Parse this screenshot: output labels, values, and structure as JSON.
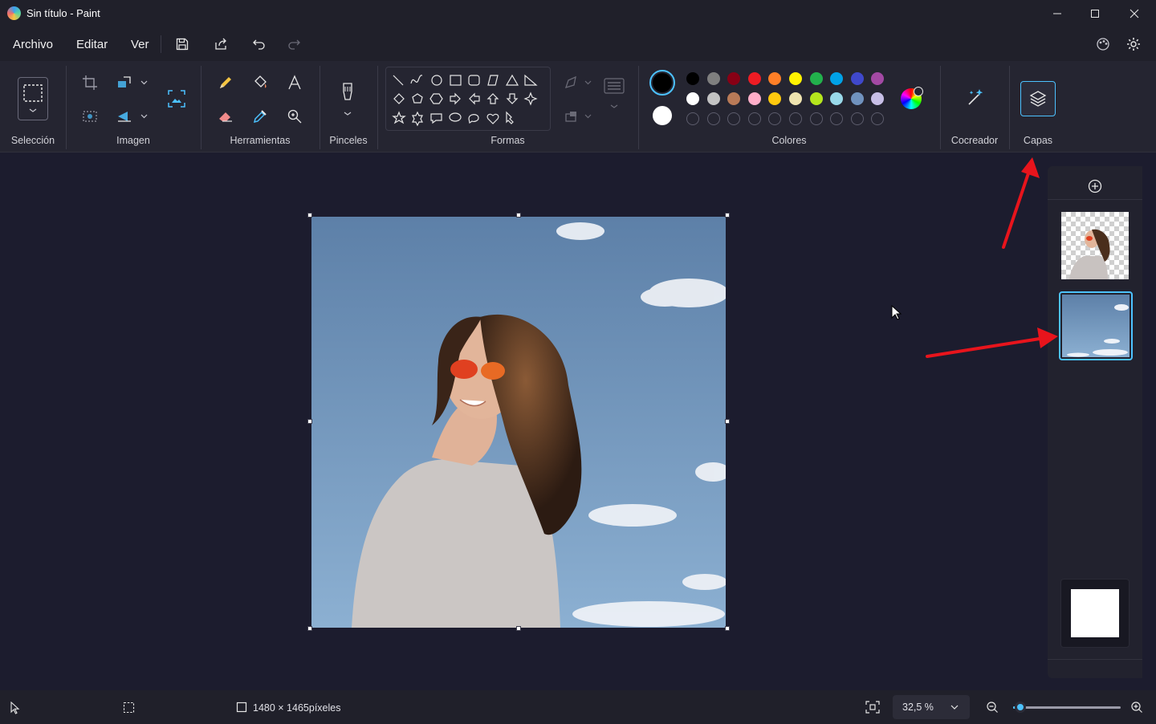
{
  "window": {
    "title": "Sin título - Paint"
  },
  "menu": {
    "items": [
      "Archivo",
      "Editar",
      "Ver"
    ]
  },
  "ribbon": {
    "groups": {
      "seleccion": "Selección",
      "imagen": "Imagen",
      "herramientas": "Herramientas",
      "pinceles": "Pinceles",
      "formas": "Formas",
      "colores": "Colores",
      "cocreador": "Cocreador",
      "capas": "Capas"
    },
    "colors": {
      "primary": "#000000",
      "secondary": "#ffffff",
      "row1": [
        "#000000",
        "#7f7f7f",
        "#880015",
        "#ed1c24",
        "#ff7f27",
        "#fff200",
        "#22b14c",
        "#00a2e8",
        "#3f48cc",
        "#a349a4"
      ],
      "row2": [
        "#ffffff",
        "#c3c3c3",
        "#b97a57",
        "#ffaec9",
        "#ffc90e",
        "#efe4b0",
        "#b5e61d",
        "#99d9ea",
        "#7092be",
        "#c8bfe7"
      ],
      "row3_empty_count": 10
    }
  },
  "statusbar": {
    "canvas_size": "1480 × 1465píxeles",
    "zoom": "32,5 %",
    "zoom_slider_fraction": 0.02
  },
  "theme": {
    "accent": "#4cc2ff",
    "annotation_arrow": "#e8141c"
  }
}
